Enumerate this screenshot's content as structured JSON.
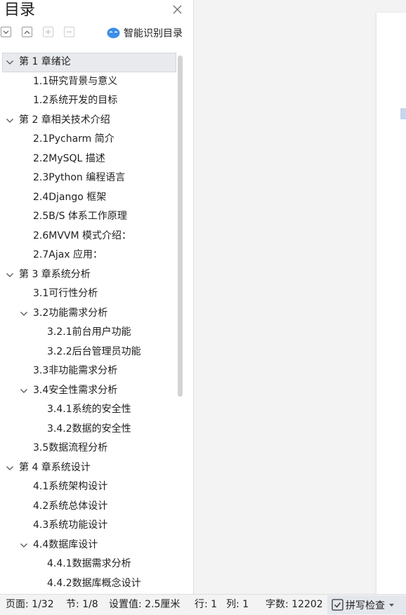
{
  "panel": {
    "title": "目录",
    "smart_toc_label": "智能识别目录"
  },
  "toc": [
    {
      "label": "第 1 章绪论",
      "level": 0,
      "expanded": true,
      "active": true
    },
    {
      "label": "1.1研究背景与意义",
      "level": 1
    },
    {
      "label": "1.2系统开发的目标",
      "level": 1
    },
    {
      "label": "第 2 章相关技术介绍",
      "level": 0,
      "expanded": true
    },
    {
      "label": "2.1Pycharm 简介",
      "level": 1
    },
    {
      "label": "2.2MySQL 描述",
      "level": 1
    },
    {
      "label": "2.3Python 编程语言",
      "level": 1
    },
    {
      "label": "2.4Django 框架",
      "level": 1
    },
    {
      "label": "2.5B/S 体系工作原理",
      "level": 1
    },
    {
      "label": "2.6MVVM 模式介绍：",
      "level": 1
    },
    {
      "label": "2.7Ajax  应用：",
      "level": 1
    },
    {
      "label": "第 3 章系统分析",
      "level": 0,
      "expanded": true
    },
    {
      "label": "3.1可行性分析",
      "level": 1
    },
    {
      "label": "3.2功能需求分析",
      "level": 1,
      "expanded": true
    },
    {
      "label": "3.2.1前台用户功能",
      "level": 2
    },
    {
      "label": "3.2.2后台管理员功能",
      "level": 2
    },
    {
      "label": "3.3非功能需求分析",
      "level": 1
    },
    {
      "label": "3.4安全性需求分析",
      "level": 1,
      "expanded": true
    },
    {
      "label": "3.4.1系统的安全性",
      "level": 2
    },
    {
      "label": "3.4.2数据的安全性",
      "level": 2
    },
    {
      "label": "3.5数据流程分析",
      "level": 1
    },
    {
      "label": "第 4 章系统设计",
      "level": 0,
      "expanded": true
    },
    {
      "label": "4.1系统架构设计",
      "level": 1
    },
    {
      "label": "4.2系统总体设计",
      "level": 1
    },
    {
      "label": "4.3系统功能设计",
      "level": 1
    },
    {
      "label": "4.4数据库设计",
      "level": 1,
      "expanded": true
    },
    {
      "label": "4.4.1数据需求分析",
      "level": 2
    },
    {
      "label": "4.4.2数据库概念设计",
      "level": 2
    }
  ],
  "status": {
    "page": "页面: 1/32",
    "section": "节: 1/8",
    "setting": "设置值: 2.5厘米",
    "row": "行: 1",
    "col": "列: 1",
    "words": "字数: 12202",
    "spell_check": "拼写检查"
  },
  "colors": {
    "accent": "#3b8fe8",
    "active_row": "#e8eaed",
    "status_button": "#e4e7ec"
  }
}
